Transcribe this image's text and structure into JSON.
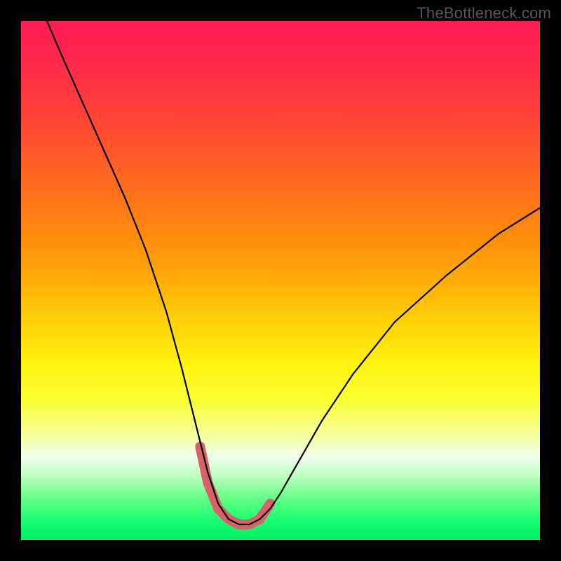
{
  "watermark": "TheBottleneck.com",
  "chart_data": {
    "type": "line",
    "title": "",
    "xlabel": "",
    "ylabel": "",
    "xlim": [
      0,
      100
    ],
    "ylim": [
      0,
      100
    ],
    "series": [
      {
        "name": "bottleneck-curve",
        "x": [
          5,
          8,
          12,
          16,
          20,
          24,
          28,
          31,
          33.5,
          36,
          38,
          40,
          42,
          44,
          46,
          48,
          50,
          54,
          58,
          64,
          72,
          82,
          92,
          100
        ],
        "y": [
          100,
          93,
          84,
          75,
          66,
          56,
          44,
          33,
          23,
          13,
          7,
          4,
          3,
          3,
          4,
          6,
          9,
          16,
          23,
          32,
          42,
          51,
          59,
          64
        ]
      },
      {
        "name": "optimal-zone",
        "x": [
          34.5,
          36,
          38,
          40,
          42,
          44,
          46,
          48
        ],
        "y": [
          18,
          11,
          6,
          4,
          3,
          3,
          4,
          7
        ]
      }
    ],
    "colors": {
      "curve": "#000000",
      "highlight": "#d9616a"
    }
  }
}
